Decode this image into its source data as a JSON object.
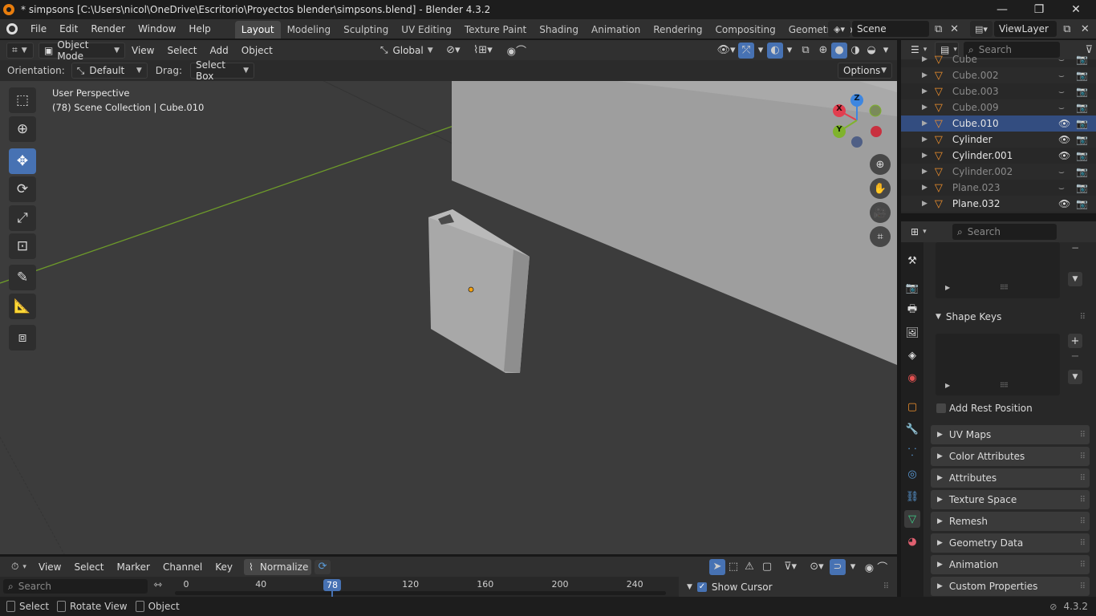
{
  "titlebar": {
    "title": "* simpsons [C:\\Users\\nicol\\OneDrive\\Escritorio\\Proyectos blender\\simpsons.blend] - Blender 4.3.2",
    "minimize": "—",
    "maximize": "❐",
    "close": "✕"
  },
  "menubar": {
    "items": [
      "File",
      "Edit",
      "Render",
      "Window",
      "Help"
    ],
    "workspaces": [
      "Layout",
      "Modeling",
      "Sculpting",
      "UV Editing",
      "Texture Paint",
      "Shading",
      "Animation",
      "Rendering",
      "Compositing",
      "Geometry Node"
    ],
    "active_workspace": "Layout",
    "scene": "Scene",
    "view_layer": "ViewLayer"
  },
  "viewport_header": {
    "mode": "Object Mode",
    "menus": [
      "View",
      "Select",
      "Add",
      "Object"
    ],
    "transform_orientation": "Global"
  },
  "tool_settings": {
    "orientation_label": "Orientation:",
    "orientation_value": "Default",
    "drag_label": "Drag:",
    "drag_value": "Select Box",
    "options": "Options"
  },
  "viewport": {
    "view_name": "User Perspective",
    "context": "(78) Scene Collection | Cube.010",
    "gizmo": {
      "x": "X",
      "y": "Y",
      "z": "Z"
    },
    "colors": {
      "x_axis": "#e23e4f",
      "y_axis": "#7fb32c",
      "z_axis": "#3d86e0",
      "background": "#3c3c3c",
      "origin": "#f7a20f"
    }
  },
  "outliner": {
    "search_placeholder": "Search",
    "rows": [
      {
        "name": "Cube",
        "dim": true,
        "visible": false
      },
      {
        "name": "Cube.002",
        "dim": true,
        "visible": false
      },
      {
        "name": "Cube.003",
        "dim": true,
        "visible": false
      },
      {
        "name": "Cube.009",
        "dim": true,
        "visible": false
      },
      {
        "name": "Cube.010",
        "dim": false,
        "visible": true,
        "selected": true
      },
      {
        "name": "Cylinder",
        "dim": false,
        "visible": true
      },
      {
        "name": "Cylinder.001",
        "dim": false,
        "visible": true
      },
      {
        "name": "Cylinder.002",
        "dim": true,
        "visible": false
      },
      {
        "name": "Plane.023",
        "dim": true,
        "visible": false
      },
      {
        "name": "Plane.032",
        "dim": false,
        "visible": true
      }
    ]
  },
  "properties": {
    "search_placeholder": "Search",
    "shape_keys": "Shape Keys",
    "add_rest_position": "Add Rest Position",
    "panels": [
      "UV Maps",
      "Color Attributes",
      "Attributes",
      "Texture Space",
      "Remesh",
      "Geometry Data",
      "Animation",
      "Custom Properties"
    ]
  },
  "timeline": {
    "menus": [
      "View",
      "Select",
      "Marker",
      "Channel",
      "Key"
    ],
    "normalize": "Normalize",
    "search_placeholder": "Search",
    "current_frame": "78",
    "ticks": [
      "0",
      "40",
      "120",
      "160",
      "200",
      "240"
    ],
    "show_cursor": "Show Cursor"
  },
  "statusbar": {
    "select": "Select",
    "rotate_view": "Rotate View",
    "object": "Object",
    "version": "4.3.2"
  }
}
